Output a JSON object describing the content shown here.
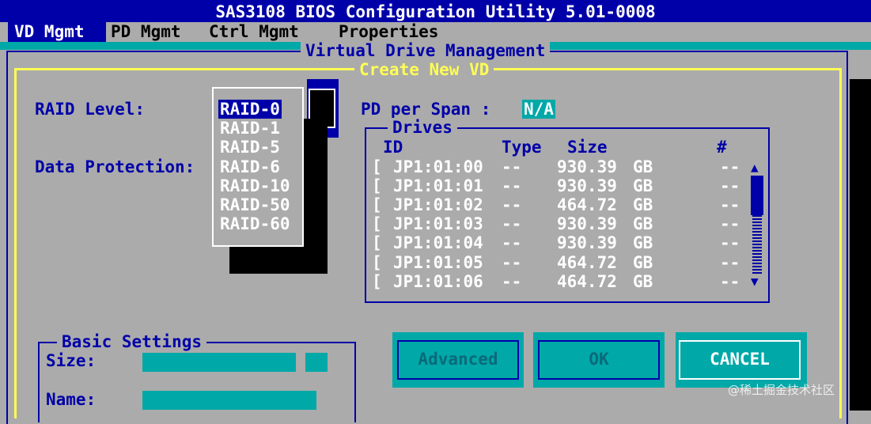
{
  "title": "SAS3108 BIOS Configuration Utility 5.01-0008",
  "menu": [
    "VD Mgmt",
    "PD Mgmt",
    "Ctrl Mgmt",
    "Properties"
  ],
  "outer_title": "Virtual Drive Management",
  "dialog_title": "Create New VD",
  "raid_label": "RAID Level:",
  "data_protection_label": "Data Protection:",
  "raid_options": [
    "RAID-0",
    "RAID-1",
    "RAID-5",
    "RAID-6",
    "RAID-10",
    "RAID-50",
    "RAID-60"
  ],
  "pd_per_span_label": "PD per Span :",
  "pd_per_span_value": "N/A",
  "drives": {
    "title": "Drives",
    "headers": {
      "id": "ID",
      "type": "Type",
      "size": "Size",
      "num": "#"
    },
    "rows": [
      {
        "check": "[",
        "id": "JP1:01:00",
        "type": "--",
        "size": "930.39",
        "unit": "GB",
        "num": "--"
      },
      {
        "check": "[",
        "id": "JP1:01:01",
        "type": "--",
        "size": "930.39",
        "unit": "GB",
        "num": "--"
      },
      {
        "check": "[",
        "id": "JP1:01:02",
        "type": "--",
        "size": "464.72",
        "unit": "GB",
        "num": "--"
      },
      {
        "check": "[",
        "id": "JP1:01:03",
        "type": "--",
        "size": "930.39",
        "unit": "GB",
        "num": "--"
      },
      {
        "check": "[",
        "id": "JP1:01:04",
        "type": "--",
        "size": "930.39",
        "unit": "GB",
        "num": "--"
      },
      {
        "check": "[",
        "id": "JP1:01:05",
        "type": "--",
        "size": "464.72",
        "unit": "GB",
        "num": "--"
      },
      {
        "check": "[",
        "id": "JP1:01:06",
        "type": "--",
        "size": "464.72",
        "unit": "GB",
        "num": "--"
      }
    ]
  },
  "basic_settings": {
    "title": "Basic Settings",
    "size_label": "Size:",
    "name_label": "Name:"
  },
  "buttons": {
    "advanced": "Advanced",
    "ok": "OK",
    "cancel": "CANCEL"
  },
  "watermark": "@稀土掘金技术社区",
  "colors": {
    "blue": "#0000a8",
    "gray": "#ababab",
    "cyan": "#00a8a8",
    "yellow": "#fefe54",
    "white": "#ffffff"
  }
}
